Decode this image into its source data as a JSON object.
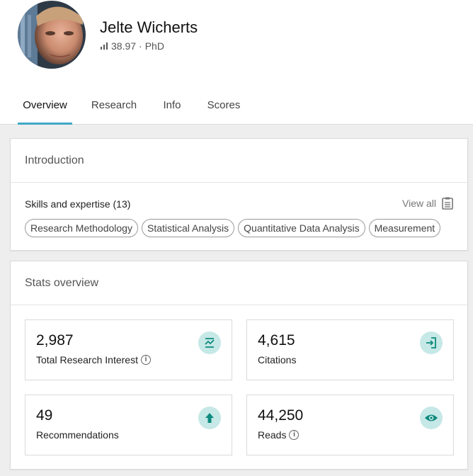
{
  "profile": {
    "name": "Jelte Wicherts",
    "score": "38.97",
    "separator": "·",
    "degree": "PhD"
  },
  "tabs": [
    {
      "label": "Overview",
      "active": true
    },
    {
      "label": "Research",
      "active": false
    },
    {
      "label": "Info",
      "active": false
    },
    {
      "label": "Scores",
      "active": false
    }
  ],
  "introduction": {
    "title": "Introduction",
    "skills_heading": "Skills and expertise (13)",
    "view_all": "View all",
    "skills": [
      "Research Methodology",
      "Statistical Analysis",
      "Quantitative Data Analysis",
      "Measurement"
    ]
  },
  "stats": {
    "title": "Stats overview",
    "items": [
      {
        "value": "2,987",
        "label": "Total Research Interest",
        "icon": "research-interest-icon",
        "info": true
      },
      {
        "value": "4,615",
        "label": "Citations",
        "icon": "citations-icon",
        "info": false
      },
      {
        "value": "49",
        "label": "Recommendations",
        "icon": "recommendation-arrow-icon",
        "info": false
      },
      {
        "value": "44,250",
        "label": "Reads",
        "icon": "eye-icon",
        "info": true
      }
    ]
  },
  "colors": {
    "accent": "#40a8c4",
    "badge_bg": "#c6e8e6",
    "badge_icon": "#0e8a7e"
  }
}
